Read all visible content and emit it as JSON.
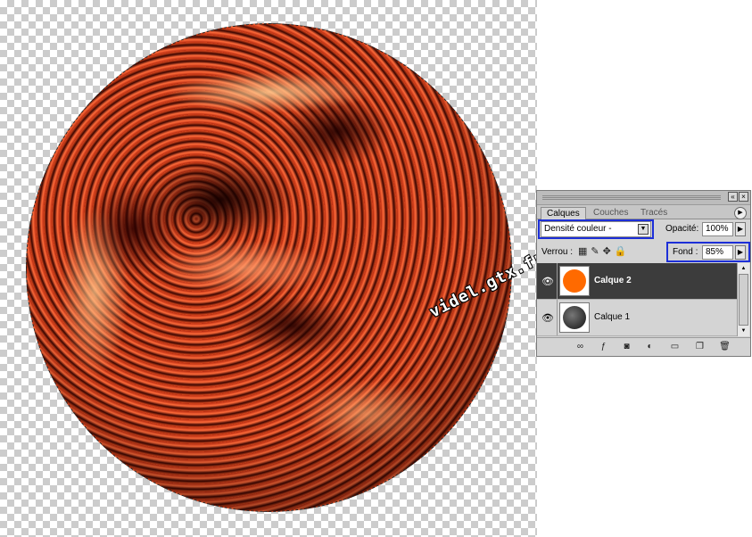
{
  "watermark": "videl.gtx.fr",
  "panel": {
    "tabs": [
      "Calques",
      "Couches",
      "Tracés"
    ],
    "blend_mode": "Densité couleur -",
    "opacity_label": "Opacité:",
    "opacity_value": "100%",
    "lock_label": "Verrou :",
    "fill_label": "Fond :",
    "fill_value": "85%",
    "layers": [
      {
        "name": "Calque 2",
        "selected": true,
        "thumb_color": "#ff6a00"
      },
      {
        "name": "Calque 1",
        "selected": false,
        "thumb_color": "#2a2a2a"
      }
    ]
  },
  "colors": {
    "highlight": "#1d2fd8",
    "selected_row": "#3c3c3c"
  },
  "icons": {
    "lock": [
      "lock-transparency-icon",
      "lock-pixels-icon",
      "lock-position-icon",
      "lock-all-icon"
    ],
    "footer": [
      "link-layers-icon",
      "layer-style-icon",
      "layer-mask-icon",
      "adjustment-layer-icon",
      "new-group-icon",
      "new-layer-icon",
      "delete-layer-icon"
    ]
  }
}
